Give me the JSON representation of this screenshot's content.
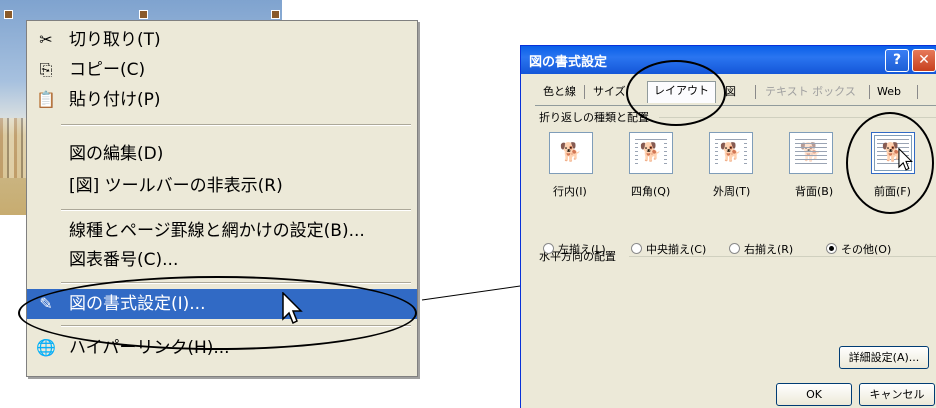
{
  "context_menu": {
    "items": [
      {
        "icon": "scissors-icon",
        "glyph": "✂",
        "label": "切り取り(T)"
      },
      {
        "icon": "copy-icon",
        "glyph": "⎘",
        "label": "コピー(C)"
      },
      {
        "icon": "paste-icon",
        "glyph": "📋",
        "label": "貼り付け(P)"
      },
      {
        "label": "図の編集(D)"
      },
      {
        "label": "[図] ツールバーの非表示(R)"
      },
      {
        "label": "線種とページ罫線と網かけの設定(B)..."
      },
      {
        "label": "図表番号(C)..."
      },
      {
        "icon": "format-picture-icon",
        "glyph": "✎",
        "label": "図の書式設定(I)..."
      },
      {
        "icon": "hyperlink-globe-icon",
        "glyph": "🌐",
        "label": "ハイパーリンク(H)..."
      }
    ],
    "active_index": 7
  },
  "dialog": {
    "title": "図の書式設定",
    "help_glyph": "?",
    "close_glyph": "✕",
    "tabs": [
      {
        "label": "色と線",
        "state": "normal"
      },
      {
        "label": "サイズ",
        "state": "normal"
      },
      {
        "label": "レイアウト",
        "state": "selected"
      },
      {
        "label": "図",
        "state": "normal"
      },
      {
        "label": "テキスト ボックス",
        "state": "disabled"
      },
      {
        "label": "Web",
        "state": "normal"
      }
    ],
    "wrap_group_label": "折り返しの種類と配置",
    "wrap_options": [
      {
        "label": "行内(I)",
        "selected": false
      },
      {
        "label": "四角(Q)",
        "selected": false
      },
      {
        "label": "外周(T)",
        "selected": false
      },
      {
        "label": "背面(B)",
        "selected": false
      },
      {
        "label": "前面(F)",
        "selected": true
      }
    ],
    "align_group_label": "水平方向の配置",
    "align_options": [
      {
        "label": "左揃え(L)",
        "checked": false
      },
      {
        "label": "中央揃え(C)",
        "checked": false
      },
      {
        "label": "右揃え(R)",
        "checked": false
      },
      {
        "label": "その他(O)",
        "checked": true
      }
    ],
    "advanced_button": "詳細設定(A)...",
    "ok_button": "OK",
    "cancel_button": "キャンセル"
  },
  "colors": {
    "menu_highlight": "#316ac5",
    "titlebar": "#0a5fe8",
    "menu_bg": "#ece9d8"
  }
}
